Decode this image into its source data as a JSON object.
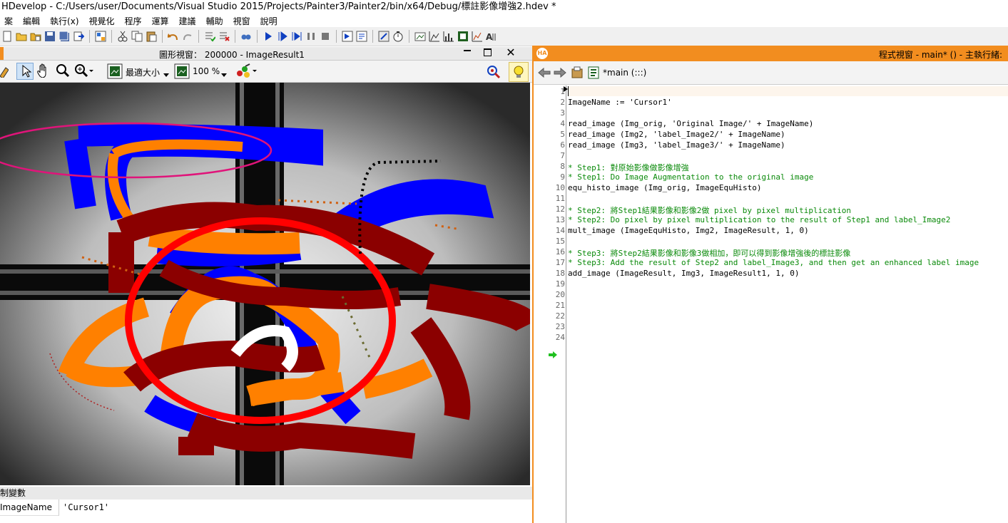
{
  "window": {
    "title": "HDevelop - C:/Users/user/Documents/Visual Studio 2015/Projects/Painter3/Painter2/bin/x64/Debug/標註影像增強2.hdev *"
  },
  "menu": [
    "案",
    "編輯",
    "執行(x)",
    "視覺化",
    "程序",
    "運算",
    "建議",
    "輔助",
    "視窗",
    "說明"
  ],
  "graphics_window": {
    "title": "圖形視窗： 200000 - ImageResult1",
    "zoom_mode": "最適大小",
    "zoom_percent": "100 %"
  },
  "variables_panel": {
    "header": "制變數",
    "rows": [
      {
        "name": "ImageName",
        "value": "'Cursor1'"
      }
    ]
  },
  "program_window": {
    "title": "程式視窗 - main* () - 主執行緒:",
    "procedure": "*main (:::)",
    "lines": [
      {
        "n": "1",
        "text": "",
        "type": "code"
      },
      {
        "n": "2",
        "text": "ImageName := 'Cursor1'",
        "type": "code"
      },
      {
        "n": "3",
        "text": "",
        "type": "code"
      },
      {
        "n": "4",
        "text": "read_image (Img_orig, 'Original Image/' + ImageName)",
        "type": "code"
      },
      {
        "n": "5",
        "text": "read_image (Img2, 'label_Image2/' + ImageName)",
        "type": "code"
      },
      {
        "n": "6",
        "text": "read_image (Img3, 'label_Image3/' + ImageName)",
        "type": "code"
      },
      {
        "n": "7",
        "text": "",
        "type": "code"
      },
      {
        "n": "8",
        "text": "* Step1: 對原始影像做影像增強",
        "type": "comment"
      },
      {
        "n": "9",
        "text": "* Step1: Do Image Augmentation to the original image",
        "type": "comment"
      },
      {
        "n": "10",
        "text": "equ_histo_image (Img_orig, ImageEquHisto)",
        "type": "code"
      },
      {
        "n": "11",
        "text": "",
        "type": "code"
      },
      {
        "n": "12",
        "text": "* Step2: 將Step1結果影像和影像2做 pixel by pixel multiplication",
        "type": "comment"
      },
      {
        "n": "13",
        "text": "* Step2: Do pixel by pixel multiplication to the result of Step1 and label_Image2",
        "type": "comment"
      },
      {
        "n": "14",
        "text": "mult_image (ImageEquHisto, Img2, ImageResult, 1, 0)",
        "type": "code"
      },
      {
        "n": "15",
        "text": "",
        "type": "code"
      },
      {
        "n": "16",
        "text": "* Step3: 將Step2結果影像和影像3做相加，即可以得到影像增強後的標註影像",
        "type": "comment"
      },
      {
        "n": "17",
        "text": "* Step3: Add the result of Step2 and label_Image3, and then get an enhanced label image",
        "type": "comment"
      },
      {
        "n": "18",
        "text": "add_image (ImageResult, Img3, ImageResult1, 1, 0)",
        "type": "code"
      },
      {
        "n": "19",
        "text": "",
        "type": "code"
      },
      {
        "n": "20",
        "text": "",
        "type": "code"
      },
      {
        "n": "21",
        "text": "",
        "type": "code"
      },
      {
        "n": "22",
        "text": "",
        "type": "code"
      },
      {
        "n": "23",
        "text": "",
        "type": "code"
      },
      {
        "n": "24",
        "text": "",
        "type": "code"
      }
    ]
  },
  "colors": {
    "program_title_bar": "#f28d1f",
    "comment": "#0a8a0a",
    "paint_red": "#ff0000",
    "paint_darkred": "#8b0000",
    "paint_orange": "#ff8000",
    "paint_blue": "#0000ff",
    "paint_magenta": "#e0147a"
  }
}
